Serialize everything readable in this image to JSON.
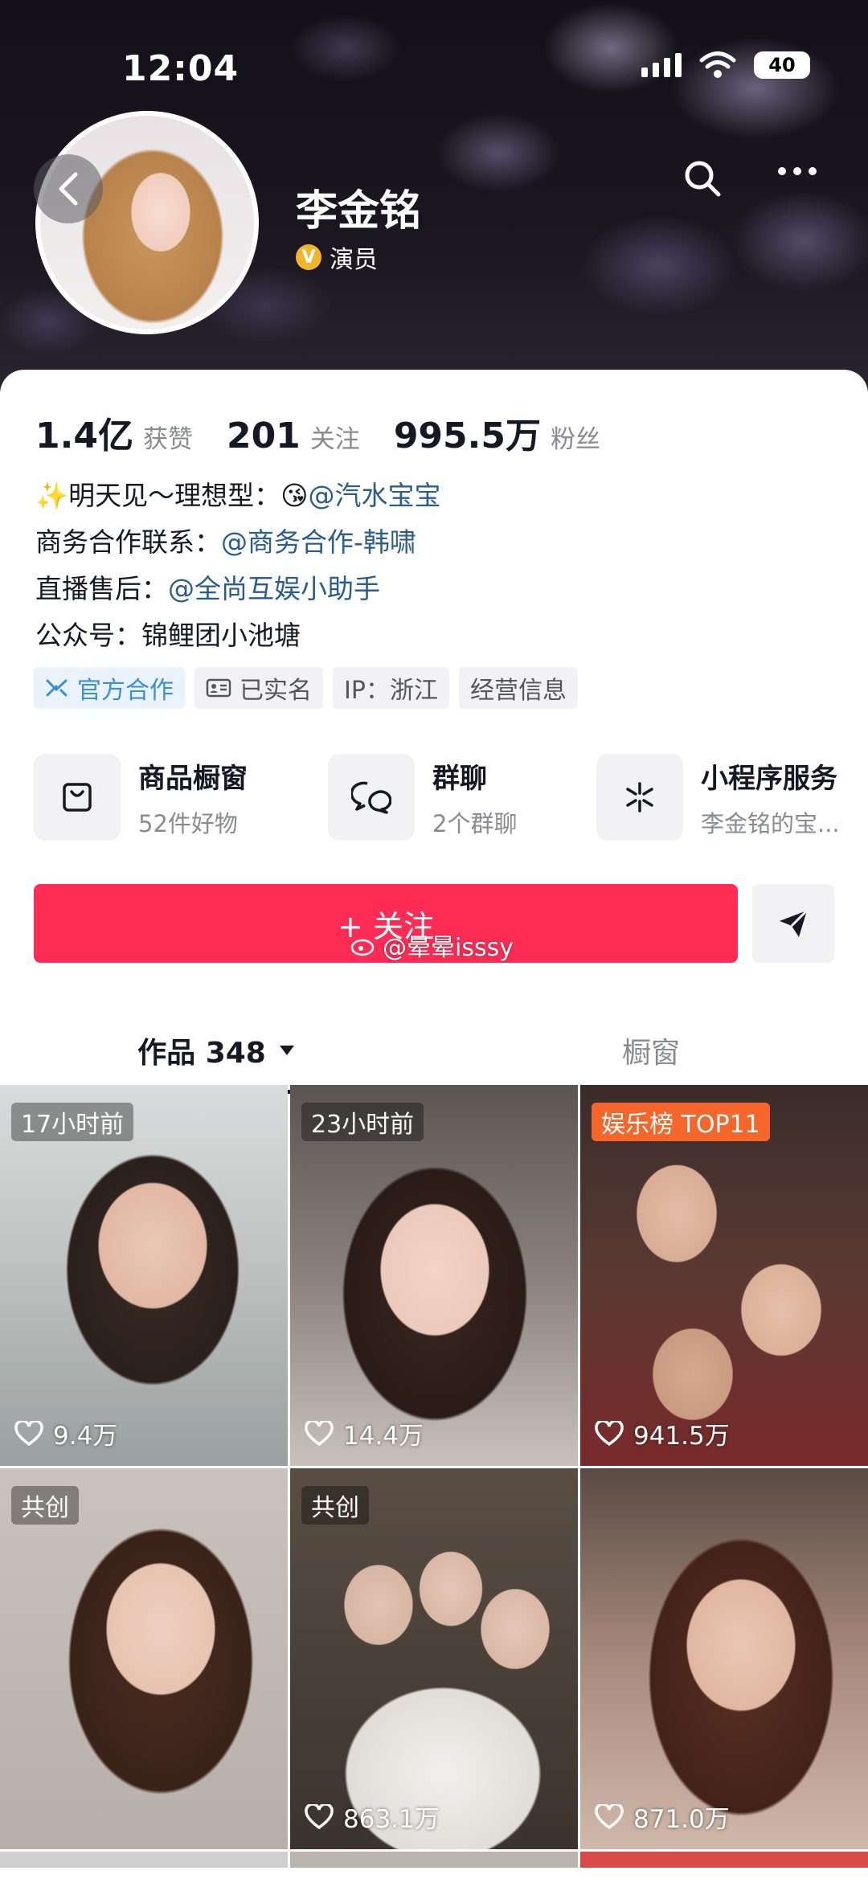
{
  "status_bar": {
    "time": "12:04",
    "battery": "40"
  },
  "profile": {
    "name": "李金铭",
    "verified_label": "演员"
  },
  "stats": [
    {
      "value": "1.4亿",
      "label": "获赞"
    },
    {
      "value": "201",
      "label": "关注"
    },
    {
      "value": "995.5万",
      "label": "粉丝"
    }
  ],
  "bio": {
    "line1_prefix": "✨明天见～理想型：",
    "line1_emoji": "😘",
    "line1_link": "@汽水宝宝",
    "line2_prefix": "商务合作联系：",
    "line2_link": "@商务合作-韩啸",
    "line3_prefix": "直播售后：",
    "line3_link": "@全尚互娱小助手",
    "line4": "公众号：锦鲤团小池塘"
  },
  "tags": [
    "官方合作",
    "已实名",
    "IP：浙江",
    "经营信息"
  ],
  "services": [
    {
      "title": "商品橱窗",
      "subtitle": "52件好物",
      "icon": "bag-icon"
    },
    {
      "title": "群聊",
      "subtitle": "2个群聊",
      "icon": "chat-icon"
    },
    {
      "title": "小程序服务",
      "subtitle": "李金铭的宝...",
      "icon": "mini-program-icon"
    }
  ],
  "follow_button": "+ 关注",
  "watermark": "@晕晕isssy",
  "tabs": {
    "works": "作品 348",
    "window": "橱窗"
  },
  "videos": [
    {
      "badge": "17小时前",
      "likes": "9.4万"
    },
    {
      "badge": "23小时前",
      "likes": "14.4万"
    },
    {
      "badge": "娱乐榜 TOP11",
      "likes": "941.5万"
    },
    {
      "badge": "共创",
      "likes": ""
    },
    {
      "badge": "共创",
      "likes": "863.1万"
    },
    {
      "badge": "",
      "likes": "871.0万"
    }
  ],
  "colors": {
    "follow": "#fe2c55",
    "link": "#2a5d8f",
    "official_tag": "#3a8fd6",
    "rank_badge": "#f5662a"
  }
}
